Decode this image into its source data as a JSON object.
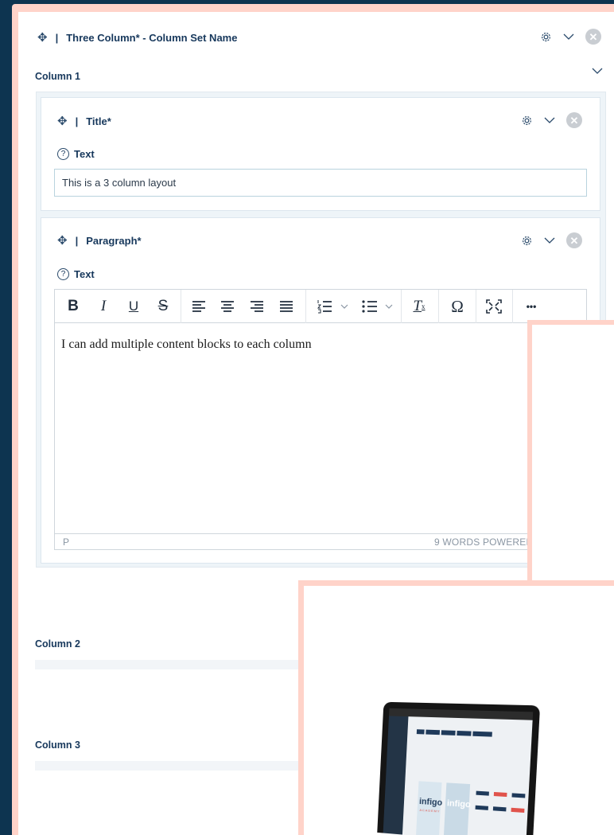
{
  "column_set": {
    "title": "Three Column* - Column Set Name",
    "separator": "|"
  },
  "columns": [
    {
      "label": "Column 1"
    },
    {
      "label": "Column 2"
    },
    {
      "label": "Column 3"
    }
  ],
  "title_block": {
    "name": "Title*",
    "field_label": "Text",
    "field_value": "This is a 3 column layout"
  },
  "paragraph_block": {
    "name": "Paragraph*",
    "field_label": "Text",
    "content": "I can add multiple content blocks to each column",
    "status_path": "P",
    "status_right": "9 WORDS  POWERED"
  },
  "toolbar": {
    "bold": "B",
    "italic": "I",
    "underline": "U",
    "strike": "S",
    "clear_format": "T",
    "special_char": "Ω",
    "more": "•••"
  },
  "icons": {
    "move": "move-icon",
    "gear": "gear-icon",
    "chevron": "chevron-down-icon",
    "close": "close-icon",
    "help": "help-icon"
  },
  "preview": {
    "brand": "infigo",
    "brand_sub": "ACADEMY"
  },
  "colors": {
    "background": "#0d3450",
    "frame": "#ffd3c9",
    "text": "#17385c"
  }
}
